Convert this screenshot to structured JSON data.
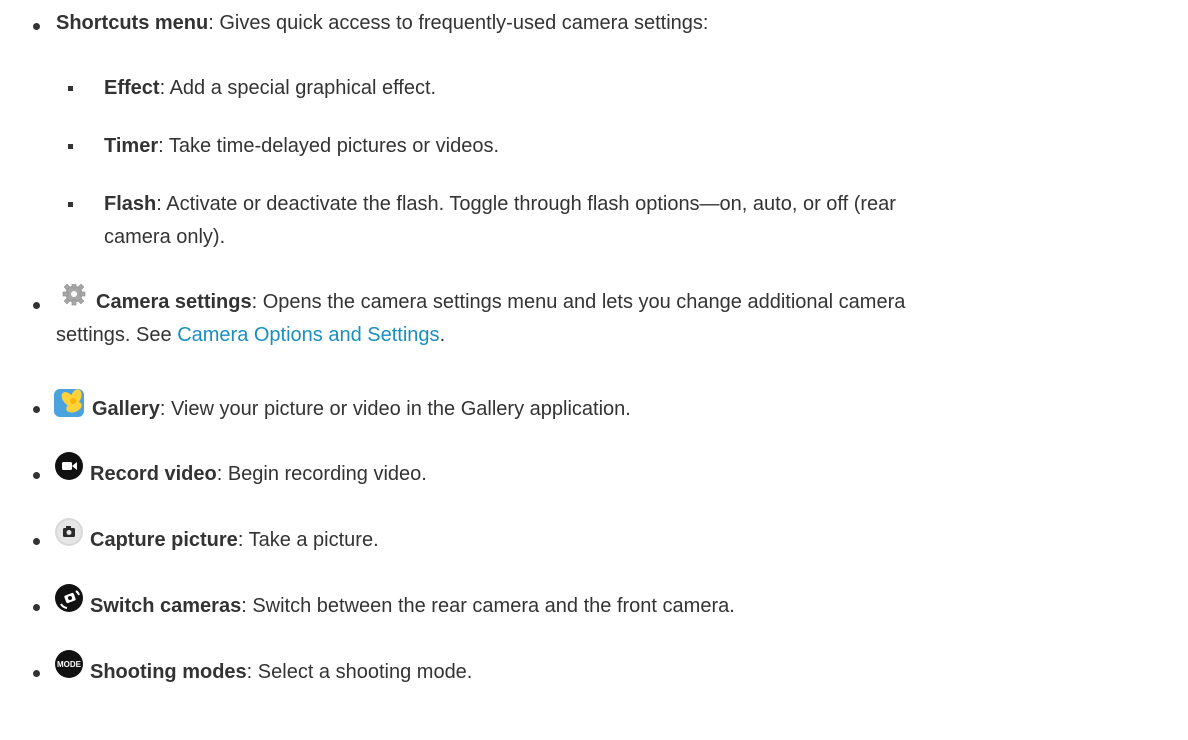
{
  "items": [
    {
      "label": "Shortcuts menu",
      "text": ": Gives quick access to frequently-used camera settings:",
      "sub": [
        {
          "label": "Effect",
          "text": ": Add a special graphical effect."
        },
        {
          "label": "Timer",
          "text": ": Take time-delayed pictures or videos."
        },
        {
          "label": "Flash",
          "text": ": Activate or deactivate the flash. Toggle through flash options—on, auto, or off (rear",
          "cont": "camera only)."
        }
      ]
    },
    {
      "icon": "gear-icon",
      "label": "Camera settings",
      "text": ": Opens the camera settings menu and lets you change additional camera",
      "line2": "settings. See ",
      "link": "Camera Options and Settings",
      "after_link": "."
    },
    {
      "icon": "gallery-icon",
      "label": "Gallery",
      "text": ": View your picture or video in the Gallery application."
    },
    {
      "icon": "record-video-icon",
      "label": "Record video",
      "text": ": Begin recording video."
    },
    {
      "icon": "capture-picture-icon",
      "label": "Capture picture",
      "text": ": Take a picture."
    },
    {
      "icon": "switch-cameras-icon",
      "label": "Switch cameras",
      "text": ": Switch between the rear camera and the front camera."
    },
    {
      "icon": "mode-icon",
      "icon_text": "MODE",
      "label": "Shooting modes",
      "text": ": Select a shooting mode."
    }
  ],
  "colors": {
    "text": "#333333",
    "link": "#1a8fbf"
  }
}
